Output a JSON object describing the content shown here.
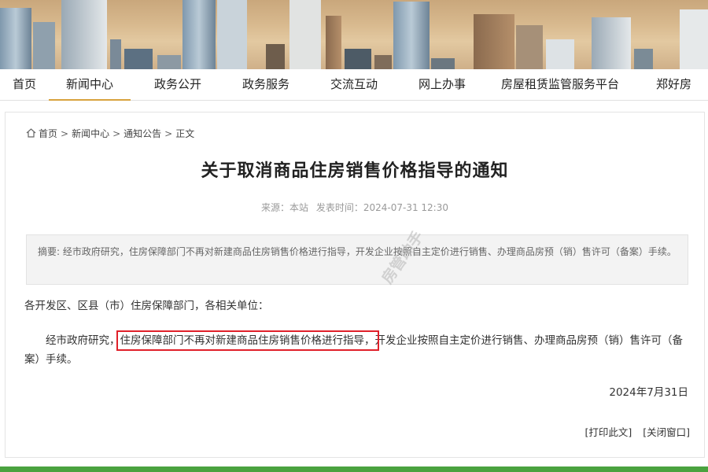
{
  "nav": {
    "items": [
      {
        "label": "首页"
      },
      {
        "label": "新闻中心"
      },
      {
        "label": "政务公开"
      },
      {
        "label": "政务服务"
      },
      {
        "label": "交流互动"
      },
      {
        "label": "网上办事"
      },
      {
        "label": "房屋租赁监管服务平台"
      },
      {
        "label": "郑好房"
      }
    ],
    "active": "新闻中心"
  },
  "breadcrumb": {
    "items": [
      "首页",
      "新闻中心",
      "通知公告",
      "正文"
    ],
    "separator": ">"
  },
  "article": {
    "title": "关于取消商品住房销售价格指导的通知",
    "source": "来源：本站",
    "published": "发表时间：2024-07-31 12:30",
    "summary": "摘要: 经市政府研究，住房保障部门不再对新建商品住房销售价格进行指导，开发企业按照自主定价进行销售、办理商品房预（销）售许可（备案）手续。",
    "greeting": "各开发区、区县（市）住房保障部门，各相关单位：",
    "para_before": "经市政府研究，",
    "para_highlight": "住房保障部门不再对新建商品住房销售价格进行指导，",
    "para_after": "开发企业按照自主定价进行销售、办理商品房预（销）售许可（备案）手续。",
    "date": "2024年7月31日"
  },
  "actions": {
    "print": "[打印此文]",
    "close": "[关闭窗口]"
  },
  "watermark": "房管助手",
  "colors": {
    "accent": "#d8a23e",
    "highlight_border": "#e0202a",
    "footer": "#4aa23f"
  }
}
